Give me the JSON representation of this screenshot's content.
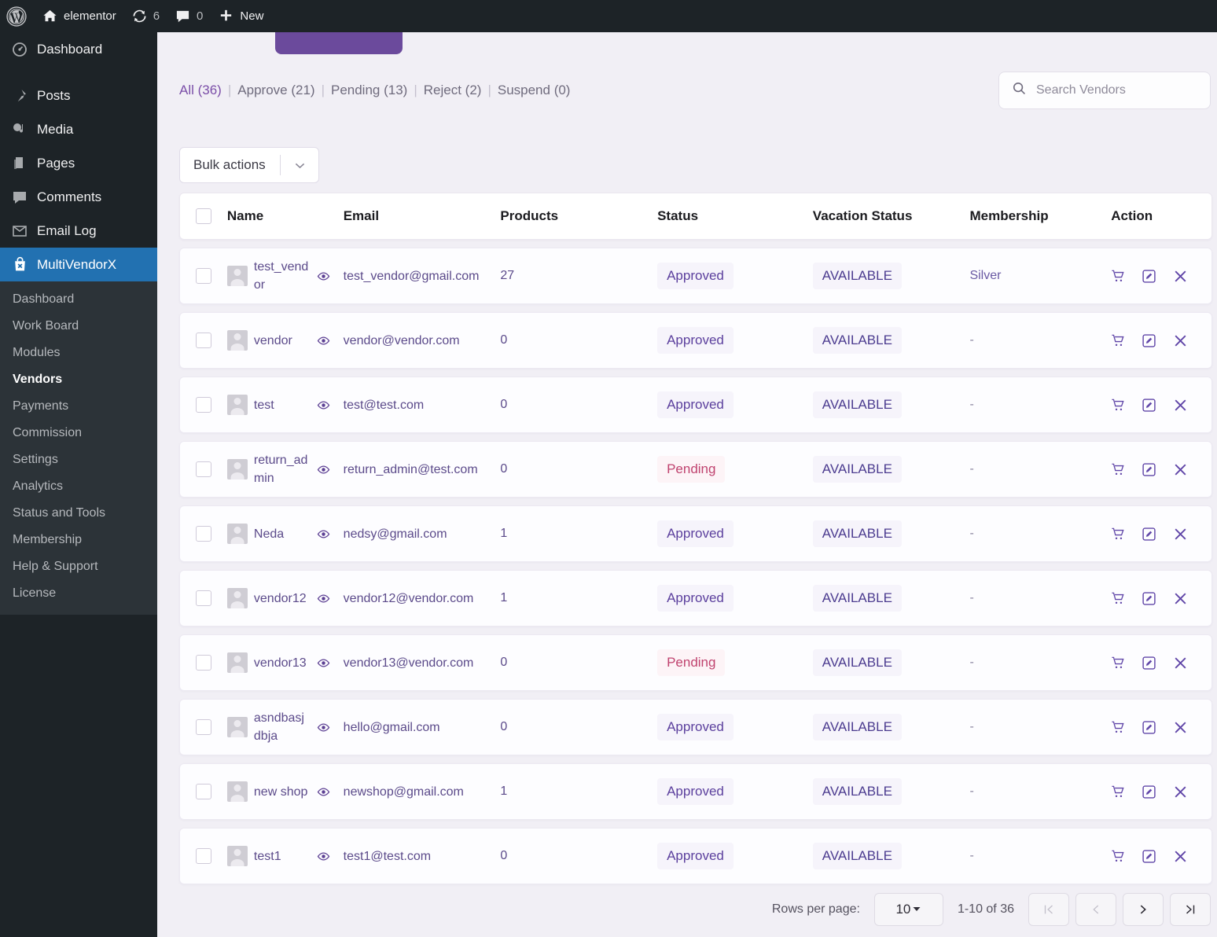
{
  "adminbar": {
    "wp_logo": "wordpress-logo",
    "site_name": "elementor",
    "updates_count": "6",
    "comments_count": "0",
    "new_label": "New"
  },
  "sidebar": {
    "items": [
      {
        "label": "Dashboard",
        "icon": "dashboard-icon"
      },
      {
        "label": "Posts",
        "icon": "pin-icon"
      },
      {
        "label": "Media",
        "icon": "media-icon"
      },
      {
        "label": "Pages",
        "icon": "pages-icon"
      },
      {
        "label": "Comments",
        "icon": "comment-icon"
      },
      {
        "label": "Email Log",
        "icon": "envelope-icon"
      },
      {
        "label": "MultiVendorX",
        "icon": "vendor-bag-icon"
      }
    ],
    "submenu": [
      {
        "label": "Dashboard"
      },
      {
        "label": "Work Board"
      },
      {
        "label": "Modules"
      },
      {
        "label": "Vendors"
      },
      {
        "label": "Payments"
      },
      {
        "label": "Commission"
      },
      {
        "label": "Settings"
      },
      {
        "label": "Analytics"
      },
      {
        "label": "Status and Tools"
      },
      {
        "label": "Membership"
      },
      {
        "label": "Help & Support"
      },
      {
        "label": "License"
      }
    ],
    "active_item": "MultiVendorX",
    "current_submenu": "Vendors"
  },
  "filters": [
    {
      "label": "All (36)",
      "active": true
    },
    {
      "label": "Approve (21)",
      "active": false
    },
    {
      "label": "Pending (13)",
      "active": false
    },
    {
      "label": "Reject (2)",
      "active": false
    },
    {
      "label": "Suspend (0)",
      "active": false
    }
  ],
  "search": {
    "placeholder": "Search Vendors",
    "value": "",
    "icon": "search-icon"
  },
  "bulk_actions": {
    "label": "Bulk actions",
    "icon": "chevron-down-icon"
  },
  "table": {
    "columns": [
      "Name",
      "Email",
      "Products",
      "Status",
      "Vacation Status",
      "Membership",
      "Action"
    ],
    "rows": [
      {
        "name": "test_vendor",
        "email": "test_vendor@gmail.com",
        "products": "27",
        "status": "Approved",
        "status_type": "approved",
        "vacation": "AVAILABLE",
        "membership": "Silver"
      },
      {
        "name": "vendor",
        "email": "vendor@vendor.com",
        "products": "0",
        "status": "Approved",
        "status_type": "approved",
        "vacation": "AVAILABLE",
        "membership": "-"
      },
      {
        "name": "test",
        "email": "test@test.com",
        "products": "0",
        "status": "Approved",
        "status_type": "approved",
        "vacation": "AVAILABLE",
        "membership": "-"
      },
      {
        "name": "return_admin",
        "email": "return_admin@test.com",
        "products": "0",
        "status": "Pending",
        "status_type": "pending",
        "vacation": "AVAILABLE",
        "membership": "-"
      },
      {
        "name": "Neda",
        "email": "nedsy@gmail.com",
        "products": "1",
        "status": "Approved",
        "status_type": "approved",
        "vacation": "AVAILABLE",
        "membership": "-"
      },
      {
        "name": "vendor12",
        "email": "vendor12@vendor.com",
        "products": "1",
        "status": "Approved",
        "status_type": "approved",
        "vacation": "AVAILABLE",
        "membership": "-"
      },
      {
        "name": "vendor13",
        "email": "vendor13@vendor.com",
        "products": "0",
        "status": "Pending",
        "status_type": "pending",
        "vacation": "AVAILABLE",
        "membership": "-"
      },
      {
        "name": "asndbasjdbja",
        "email": "hello@gmail.com",
        "products": "0",
        "status": "Approved",
        "status_type": "approved",
        "vacation": "AVAILABLE",
        "membership": "-"
      },
      {
        "name": "new shop",
        "email": "newshop@gmail.com",
        "products": "1",
        "status": "Approved",
        "status_type": "approved",
        "vacation": "AVAILABLE",
        "membership": "-"
      },
      {
        "name": "test1",
        "email": "test1@test.com",
        "products": "0",
        "status": "Approved",
        "status_type": "approved",
        "vacation": "AVAILABLE",
        "membership": "-"
      }
    ],
    "row_icons": {
      "preview": "eye-icon",
      "cart": "cart-icon",
      "edit": "edit-pencil-icon",
      "delete": "close-x-icon"
    }
  },
  "pagination": {
    "rows_per_page_label": "Rows per page:",
    "rows_per_page_value": "10",
    "range": "1-10 of 36",
    "first_icon": "first-page-icon",
    "prev_icon": "prev-page-icon",
    "next_icon": "next-page-icon",
    "last_icon": "last-page-icon"
  },
  "colors": {
    "accent_purple": "#6b4a9c",
    "sidebar_bg": "#1d2327",
    "active_menu_blue": "#2271b1",
    "page_bg": "#f1eff5",
    "status_pending": "#c0436f",
    "status_approved": "#5b3f9d"
  }
}
